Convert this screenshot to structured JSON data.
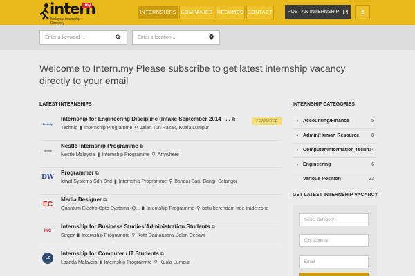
{
  "header": {
    "logo_text": "intern",
    "logo_badge": ".my",
    "logo_tagline": "Malaysia Internship Directory",
    "nav": [
      "Internships",
      "Companies",
      "Resumes",
      "Contact"
    ],
    "post_label": "Post an Internship",
    "icons": {
      "post": "external-link-icon",
      "user": "user-icon"
    }
  },
  "search": {
    "keyword_placeholder": "Enter a keyword ...",
    "location_placeholder": "Enter a location ..."
  },
  "welcome": "Welcome to Intern.my Please subscribe to get latest internship vacancy directly to your email",
  "latest": {
    "title": "Latest Internships",
    "featured_label": "Featured",
    "items": [
      {
        "title": "Internship for Engineering Discipline (Intake September 2014 –...",
        "company": "Technip",
        "type": "Internship Programme",
        "location": "Jalan Tun Razak, Kuala Lumpur",
        "logo_text": "Technip",
        "featured": true
      },
      {
        "title": "Nestlé Internship Programme",
        "company": "Nestle Malaysia",
        "type": "Internship Programme",
        "location": "Anywhere",
        "logo_text": "Nestlé"
      },
      {
        "title": "Programmer",
        "company": "Idwal Systems Sdn Bhd",
        "type": "Internship Programme",
        "location": "Bandar Baru Bangi, Selangor",
        "logo_text": "DW"
      },
      {
        "title": "Media Designer",
        "company": "Quantum Electro Opto Systems (Q...",
        "type": "Internship Programme",
        "location": "batu berendam free trade zone",
        "logo_text": "EC"
      },
      {
        "title": "Internship for Business Studies/Administration Students",
        "company": "Singer",
        "type": "Internship Programme",
        "location": "Kota Damansara, Jalan Cecawi",
        "logo_text": "INC"
      },
      {
        "title": "Internship for Computer / IT Students",
        "company": "Lazada Malaysia",
        "type": "Internship Programme",
        "location": "Kuala Lumpur",
        "logo_text": "LZ"
      }
    ]
  },
  "categories": {
    "title": "Internship Categories",
    "items": [
      {
        "name": "Accounting/Finance",
        "count": "5",
        "arrow": true
      },
      {
        "name": "Admin/Human Resource",
        "count": "8",
        "arrow": true
      },
      {
        "name": "Computer/Information Techno",
        "count": "14",
        "arrow": true
      },
      {
        "name": "Engineering",
        "count": "6",
        "arrow": true
      },
      {
        "name": "Various Position",
        "count": "23",
        "arrow": false
      }
    ]
  },
  "subscribe": {
    "title": "Get Latest Internship Vacancy",
    "category_placeholder": "Select Category",
    "location_placeholder": "City, Country",
    "email_placeholder": "Email"
  },
  "colors": {
    "accent": "#e8b91a",
    "dark": "#3b3b3b",
    "featured": "#f3dd7e"
  }
}
